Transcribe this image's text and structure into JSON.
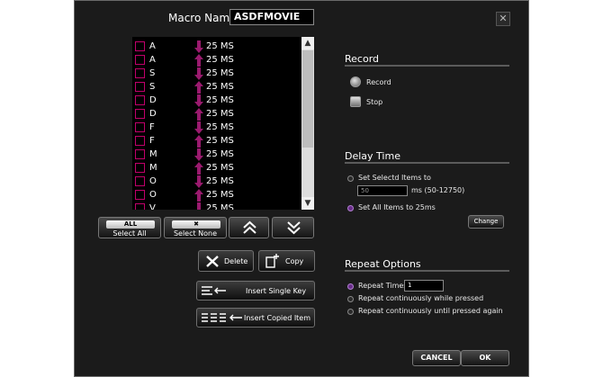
{
  "header": {
    "macro_name_label": "Macro Name",
    "macro_name_value": "ASDFMOVIE"
  },
  "list": {
    "items": [
      {
        "key": "A",
        "direction": "down",
        "delay": "25 MS"
      },
      {
        "key": "A",
        "direction": "up",
        "delay": "25 MS"
      },
      {
        "key": "S",
        "direction": "down",
        "delay": "25 MS"
      },
      {
        "key": "S",
        "direction": "up",
        "delay": "25 MS"
      },
      {
        "key": "D",
        "direction": "down",
        "delay": "25 MS"
      },
      {
        "key": "D",
        "direction": "up",
        "delay": "25 MS"
      },
      {
        "key": "F",
        "direction": "down",
        "delay": "25 MS"
      },
      {
        "key": "F",
        "direction": "up",
        "delay": "25 MS"
      },
      {
        "key": "M",
        "direction": "down",
        "delay": "25 MS"
      },
      {
        "key": "M",
        "direction": "up",
        "delay": "25 MS"
      },
      {
        "key": "O",
        "direction": "down",
        "delay": "25 MS"
      },
      {
        "key": "O",
        "direction": "up",
        "delay": "25 MS"
      },
      {
        "key": "V",
        "direction": "down",
        "delay": "25 MS"
      }
    ]
  },
  "list_buttons": {
    "select_all_top": "ALL",
    "select_all": "Select All",
    "select_none_top": "✖",
    "select_none": "Select None"
  },
  "edit": {
    "delete": "Delete",
    "copy": "Copy",
    "insert_single_key": "Insert Single Key",
    "insert_copied_item": "Insert Copied Item"
  },
  "record": {
    "title": "Record",
    "record_label": "Record",
    "stop_label": "Stop"
  },
  "delay": {
    "title": "Delay Time",
    "set_selected": "Set Selectd Items to",
    "ms_value": "50",
    "ms_range": "ms (50-12750)",
    "set_all": "Set All Items to 25ms",
    "change": "Change"
  },
  "repeat": {
    "title": "Repeat Options",
    "repeat_times_label": "Repeat Times",
    "repeat_times_value": "1",
    "while_pressed": "Repeat continuously while pressed",
    "until_pressed": "Repeat continuously until pressed again"
  },
  "footer": {
    "cancel": "CANCEL",
    "ok": "OK"
  },
  "colors": {
    "background": "#1b1b1b",
    "arrow_accent": "#9a1a6e",
    "checkbox_border": "#c0006a",
    "radio_selected": "#6a2d8a"
  },
  "icons": {
    "record": "record-icon",
    "stop": "stop-icon",
    "delete": "x-icon",
    "copy": "copy-icon",
    "move_up": "double-chevron-up-icon",
    "move_down": "double-chevron-down-icon",
    "close": "close-icon"
  }
}
